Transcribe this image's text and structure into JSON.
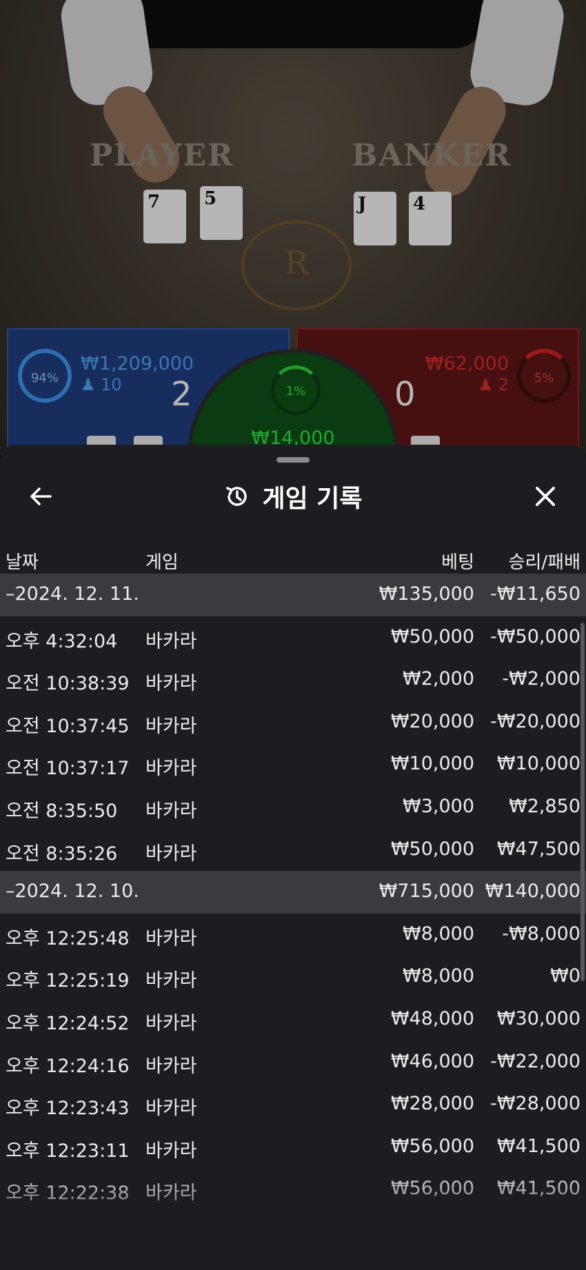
{
  "table": {
    "player_word": "PLAYER",
    "banker_word": "BANKER",
    "emblem_letter": "R",
    "player_cards": [
      "7",
      "5"
    ],
    "banker_cards": [
      "J",
      "4"
    ]
  },
  "bets": {
    "player": {
      "percent": "94%",
      "amount": "₩1,209,000",
      "count": "10",
      "score": "2",
      "color": "#1e3a78"
    },
    "banker": {
      "percent": "5%",
      "amount": "₩62,000",
      "count": "2",
      "score": "0",
      "color": "#5a1515"
    },
    "tie": {
      "percent": "1%",
      "amount": "₩14,000",
      "color": "#0f4d16"
    }
  },
  "sheet": {
    "title": "게임 기록",
    "icons": {
      "back": "back-arrow-icon",
      "history": "history-icon",
      "close": "close-icon"
    },
    "columns": {
      "date": "날짜",
      "game": "게임",
      "bet": "베팅",
      "winloss": "승리/패배"
    },
    "rows": [
      {
        "type": "date",
        "label": "–2024. 12. 11.",
        "bet": "₩135,000",
        "wl": "-₩11,650"
      },
      {
        "type": "item",
        "time": "오후 4:32:04",
        "game": "바카라",
        "bet": "₩50,000",
        "wl": "-₩50,000"
      },
      {
        "type": "item",
        "time": "오전 10:38:39",
        "game": "바카라",
        "bet": "₩2,000",
        "wl": "-₩2,000"
      },
      {
        "type": "item",
        "time": "오전 10:37:45",
        "game": "바카라",
        "bet": "₩20,000",
        "wl": "-₩20,000"
      },
      {
        "type": "item",
        "time": "오전 10:37:17",
        "game": "바카라",
        "bet": "₩10,000",
        "wl": "₩10,000"
      },
      {
        "type": "item",
        "time": "오전 8:35:50",
        "game": "바카라",
        "bet": "₩3,000",
        "wl": "₩2,850"
      },
      {
        "type": "item",
        "time": "오전 8:35:26",
        "game": "바카라",
        "bet": "₩50,000",
        "wl": "₩47,500"
      },
      {
        "type": "date",
        "label": "–2024. 12. 10.",
        "bet": "₩715,000",
        "wl": "₩140,000"
      },
      {
        "type": "item",
        "time": "오후 12:25:48",
        "game": "바카라",
        "bet": "₩8,000",
        "wl": "-₩8,000"
      },
      {
        "type": "item",
        "time": "오후 12:25:19",
        "game": "바카라",
        "bet": "₩8,000",
        "wl": "₩0"
      },
      {
        "type": "item",
        "time": "오후 12:24:52",
        "game": "바카라",
        "bet": "₩48,000",
        "wl": "₩30,000"
      },
      {
        "type": "item",
        "time": "오후 12:24:16",
        "game": "바카라",
        "bet": "₩46,000",
        "wl": "-₩22,000"
      },
      {
        "type": "item",
        "time": "오후 12:23:43",
        "game": "바카라",
        "bet": "₩28,000",
        "wl": "-₩28,000"
      },
      {
        "type": "item",
        "time": "오후 12:23:11",
        "game": "바카라",
        "bet": "₩56,000",
        "wl": "₩41,500"
      },
      {
        "type": "item",
        "time": "오후 12:22:38",
        "game": "바카라",
        "bet": "₩56,000",
        "wl": "₩41,500"
      }
    ]
  }
}
